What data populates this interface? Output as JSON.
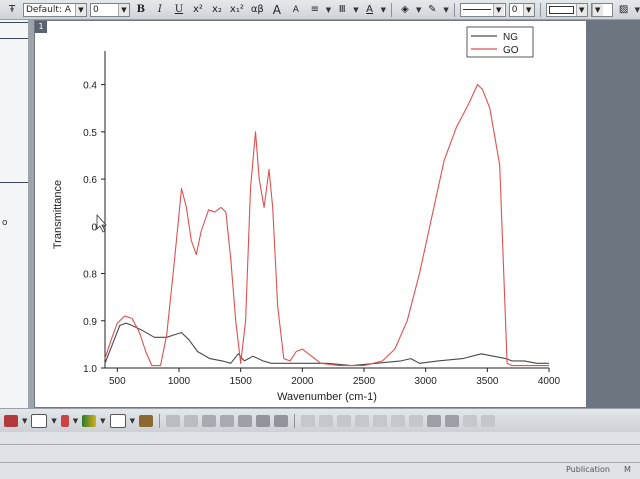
{
  "toolbar": {
    "font_select": "Default: A",
    "font_size": "0",
    "bold": "B",
    "italic": "I",
    "underline": "U",
    "superscript": "x²",
    "subscript": "x₂",
    "supsub": "x₁²",
    "greek": "αβ",
    "grow_font": "A",
    "shrink_font": "A",
    "font_color": "A",
    "line_width": "0"
  },
  "left_panel": {
    "glyph": "o"
  },
  "graph": {
    "page_tab": "1"
  },
  "chart_data": {
    "type": "line",
    "xlabel": "Wavenumber (cm-1)",
    "ylabel": "Transmittance",
    "xlim": [
      400,
      4000
    ],
    "ylim": [
      0.35,
      1.0
    ],
    "y_inverted": true,
    "xticks": [
      500,
      1000,
      1500,
      2000,
      2500,
      3000,
      3500,
      4000
    ],
    "yticks": [
      {
        "value": 0.4,
        "label": "0.4"
      },
      {
        "value": 0.5,
        "label": "0.5"
      },
      {
        "value": 0.6,
        "label": "0.6"
      },
      {
        "value": 0.7,
        "label": "0"
      },
      {
        "value": 0.8,
        "label": "0.8"
      },
      {
        "value": 0.9,
        "label": "0.9"
      },
      {
        "value": 1.0,
        "label": "1.0"
      }
    ],
    "legend_position": "top-right",
    "series": [
      {
        "name": "NG",
        "color": "#4a4a4a",
        "points": [
          [
            400,
            0.99
          ],
          [
            460,
            0.95
          ],
          [
            520,
            0.91
          ],
          [
            570,
            0.905
          ],
          [
            620,
            0.91
          ],
          [
            700,
            0.92
          ],
          [
            800,
            0.935
          ],
          [
            900,
            0.935
          ],
          [
            960,
            0.93
          ],
          [
            1020,
            0.925
          ],
          [
            1080,
            0.94
          ],
          [
            1150,
            0.965
          ],
          [
            1250,
            0.98
          ],
          [
            1350,
            0.985
          ],
          [
            1420,
            0.99
          ],
          [
            1480,
            0.97
          ],
          [
            1530,
            0.985
          ],
          [
            1600,
            0.975
          ],
          [
            1680,
            0.985
          ],
          [
            1750,
            0.99
          ],
          [
            1850,
            0.99
          ],
          [
            2000,
            0.99
          ],
          [
            2200,
            0.99
          ],
          [
            2400,
            0.995
          ],
          [
            2600,
            0.99
          ],
          [
            2800,
            0.985
          ],
          [
            2880,
            0.98
          ],
          [
            2950,
            0.99
          ],
          [
            3100,
            0.985
          ],
          [
            3300,
            0.98
          ],
          [
            3450,
            0.97
          ],
          [
            3550,
            0.975
          ],
          [
            3650,
            0.98
          ],
          [
            3700,
            0.985
          ],
          [
            3800,
            0.985
          ],
          [
            3900,
            0.99
          ],
          [
            4000,
            0.99
          ]
        ]
      },
      {
        "name": "GO",
        "color": "#e05050",
        "points": [
          [
            400,
            0.98
          ],
          [
            450,
            0.94
          ],
          [
            500,
            0.905
          ],
          [
            560,
            0.89
          ],
          [
            620,
            0.895
          ],
          [
            680,
            0.925
          ],
          [
            730,
            0.965
          ],
          [
            780,
            0.995
          ],
          [
            850,
            0.995
          ],
          [
            900,
            0.93
          ],
          [
            960,
            0.78
          ],
          [
            1020,
            0.62
          ],
          [
            1060,
            0.66
          ],
          [
            1100,
            0.73
          ],
          [
            1140,
            0.76
          ],
          [
            1180,
            0.71
          ],
          [
            1240,
            0.665
          ],
          [
            1290,
            0.67
          ],
          [
            1340,
            0.66
          ],
          [
            1380,
            0.67
          ],
          [
            1420,
            0.77
          ],
          [
            1460,
            0.9
          ],
          [
            1500,
            0.99
          ],
          [
            1540,
            0.9
          ],
          [
            1580,
            0.62
          ],
          [
            1620,
            0.5
          ],
          [
            1650,
            0.6
          ],
          [
            1690,
            0.66
          ],
          [
            1730,
            0.58
          ],
          [
            1760,
            0.66
          ],
          [
            1800,
            0.87
          ],
          [
            1850,
            0.98
          ],
          [
            1900,
            0.985
          ],
          [
            1950,
            0.965
          ],
          [
            2000,
            0.96
          ],
          [
            2050,
            0.97
          ],
          [
            2150,
            0.99
          ],
          [
            2300,
            0.995
          ],
          [
            2500,
            0.995
          ],
          [
            2650,
            0.985
          ],
          [
            2750,
            0.96
          ],
          [
            2850,
            0.9
          ],
          [
            2950,
            0.8
          ],
          [
            3050,
            0.68
          ],
          [
            3150,
            0.56
          ],
          [
            3250,
            0.49
          ],
          [
            3350,
            0.44
          ],
          [
            3420,
            0.4
          ],
          [
            3460,
            0.41
          ],
          [
            3520,
            0.45
          ],
          [
            3600,
            0.57
          ],
          [
            3660,
            0.99
          ],
          [
            3700,
            0.995
          ],
          [
            4000,
            0.995
          ]
        ]
      }
    ]
  },
  "status": {
    "tail": "Publication",
    "tail2": "M"
  }
}
